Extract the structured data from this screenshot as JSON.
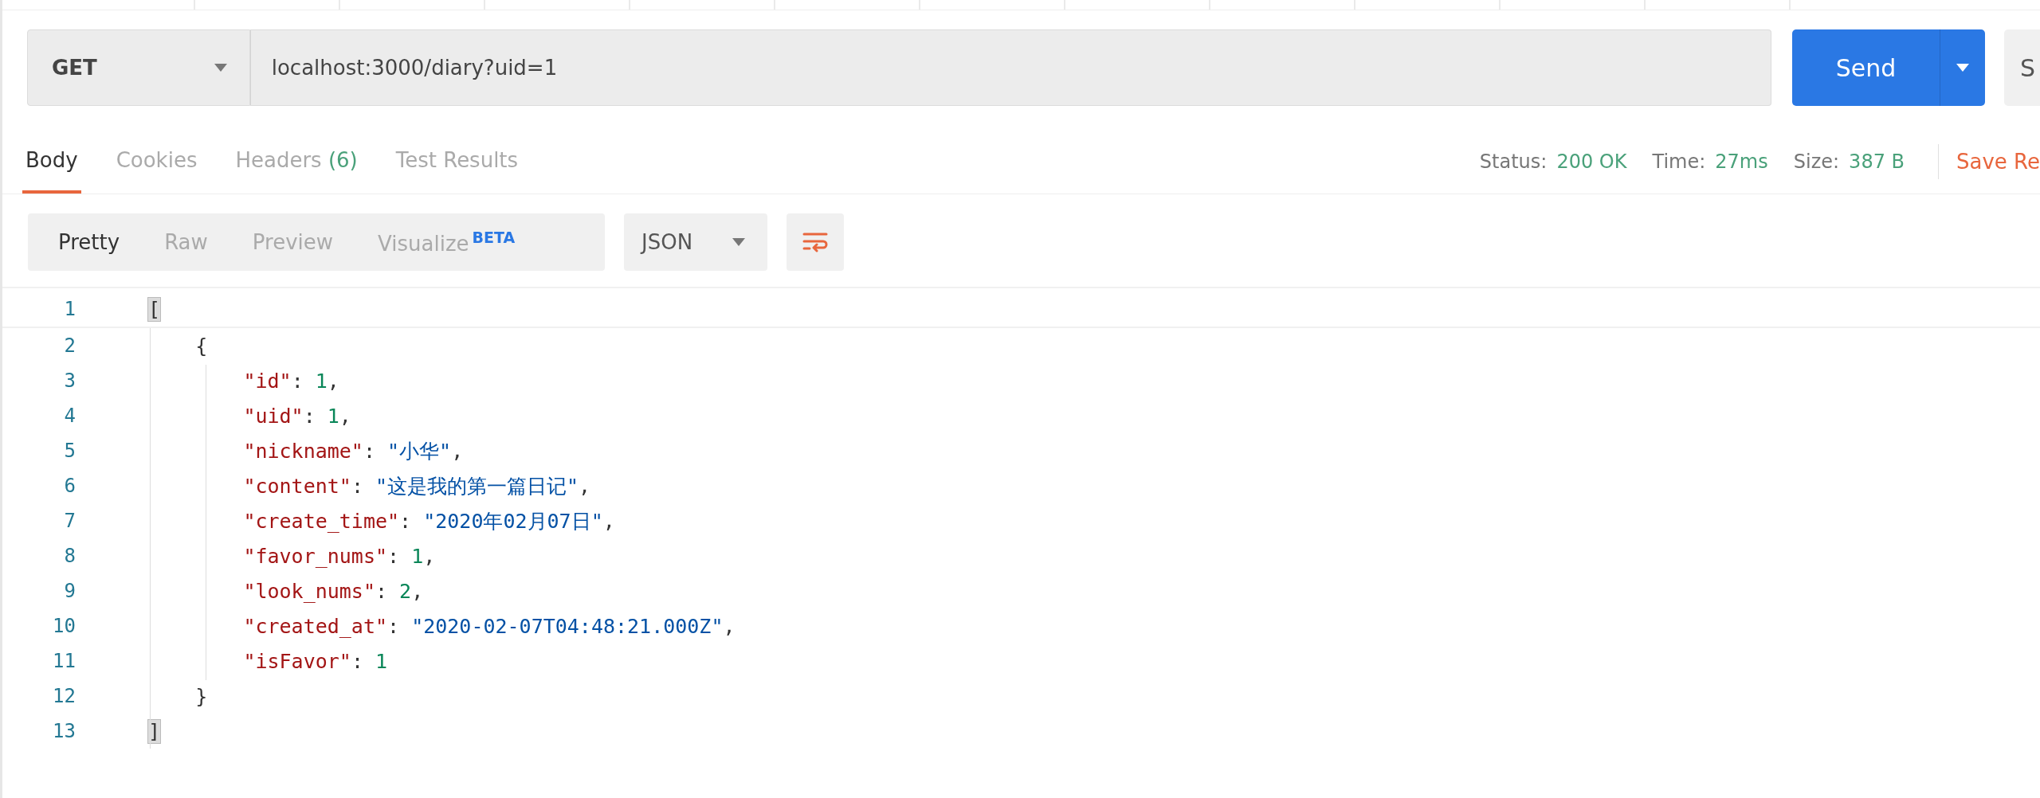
{
  "request": {
    "method": "GET",
    "url": "localhost:3000/diary?uid=1",
    "send_label": "Send",
    "cut_button_label": "S"
  },
  "response_tabs": [
    {
      "label": "Body",
      "selected": true
    },
    {
      "label": "Cookies",
      "selected": false
    },
    {
      "label": "Headers",
      "count": "(6)",
      "selected": false
    },
    {
      "label": "Test Results",
      "selected": false
    }
  ],
  "response_meta": [
    {
      "label": "Status:",
      "value": "200 OK"
    },
    {
      "label": "Time:",
      "value": "27ms"
    },
    {
      "label": "Size:",
      "value": "387 B"
    }
  ],
  "save_response": "Save Re",
  "view_tabs": [
    {
      "label": "Pretty",
      "selected": true
    },
    {
      "label": "Raw",
      "selected": false
    },
    {
      "label": "Preview",
      "selected": false
    },
    {
      "label": "Visualize",
      "badge": "BETA",
      "selected": false
    }
  ],
  "format": "JSON",
  "code_lines": [
    {
      "number": "1",
      "tokens": [
        {
          "kind": "bracket",
          "text": "["
        }
      ]
    },
    {
      "number": "2",
      "tokens": [
        {
          "kind": "punct",
          "text": "    {"
        }
      ]
    },
    {
      "number": "3",
      "tokens": [
        {
          "kind": "key",
          "text": "        \"id\""
        },
        {
          "kind": "punct",
          "text": ": "
        },
        {
          "kind": "number",
          "text": "1"
        },
        {
          "kind": "punct",
          "text": ","
        }
      ]
    },
    {
      "number": "4",
      "tokens": [
        {
          "kind": "key",
          "text": "        \"uid\""
        },
        {
          "kind": "punct",
          "text": ": "
        },
        {
          "kind": "number",
          "text": "1"
        },
        {
          "kind": "punct",
          "text": ","
        }
      ]
    },
    {
      "number": "5",
      "tokens": [
        {
          "kind": "key",
          "text": "        \"nickname\""
        },
        {
          "kind": "punct",
          "text": ": "
        },
        {
          "kind": "string",
          "text": "\"小华\""
        },
        {
          "kind": "punct",
          "text": ","
        }
      ]
    },
    {
      "number": "6",
      "tokens": [
        {
          "kind": "key",
          "text": "        \"content\""
        },
        {
          "kind": "punct",
          "text": ": "
        },
        {
          "kind": "string",
          "text": "\"这是我的第一篇日记\""
        },
        {
          "kind": "punct",
          "text": ","
        }
      ]
    },
    {
      "number": "7",
      "tokens": [
        {
          "kind": "key",
          "text": "        \"create_time\""
        },
        {
          "kind": "punct",
          "text": ": "
        },
        {
          "kind": "string",
          "text": "\"2020年02月07日\""
        },
        {
          "kind": "punct",
          "text": ","
        }
      ]
    },
    {
      "number": "8",
      "tokens": [
        {
          "kind": "key",
          "text": "        \"favor_nums\""
        },
        {
          "kind": "punct",
          "text": ": "
        },
        {
          "kind": "number",
          "text": "1"
        },
        {
          "kind": "punct",
          "text": ","
        }
      ]
    },
    {
      "number": "9",
      "tokens": [
        {
          "kind": "key",
          "text": "        \"look_nums\""
        },
        {
          "kind": "punct",
          "text": ": "
        },
        {
          "kind": "number",
          "text": "2"
        },
        {
          "kind": "punct",
          "text": ","
        }
      ]
    },
    {
      "number": "10",
      "tokens": [
        {
          "kind": "key",
          "text": "        \"created_at\""
        },
        {
          "kind": "punct",
          "text": ": "
        },
        {
          "kind": "string",
          "text": "\"2020-02-07T04:48:21.000Z\""
        },
        {
          "kind": "punct",
          "text": ","
        }
      ]
    },
    {
      "number": "11",
      "tokens": [
        {
          "kind": "key",
          "text": "        \"isFavor\""
        },
        {
          "kind": "punct",
          "text": ": "
        },
        {
          "kind": "number",
          "text": "1"
        }
      ]
    },
    {
      "number": "12",
      "tokens": [
        {
          "kind": "punct",
          "text": "    }"
        }
      ]
    },
    {
      "number": "13",
      "tokens": [
        {
          "kind": "bracket",
          "text": "]"
        }
      ]
    }
  ]
}
